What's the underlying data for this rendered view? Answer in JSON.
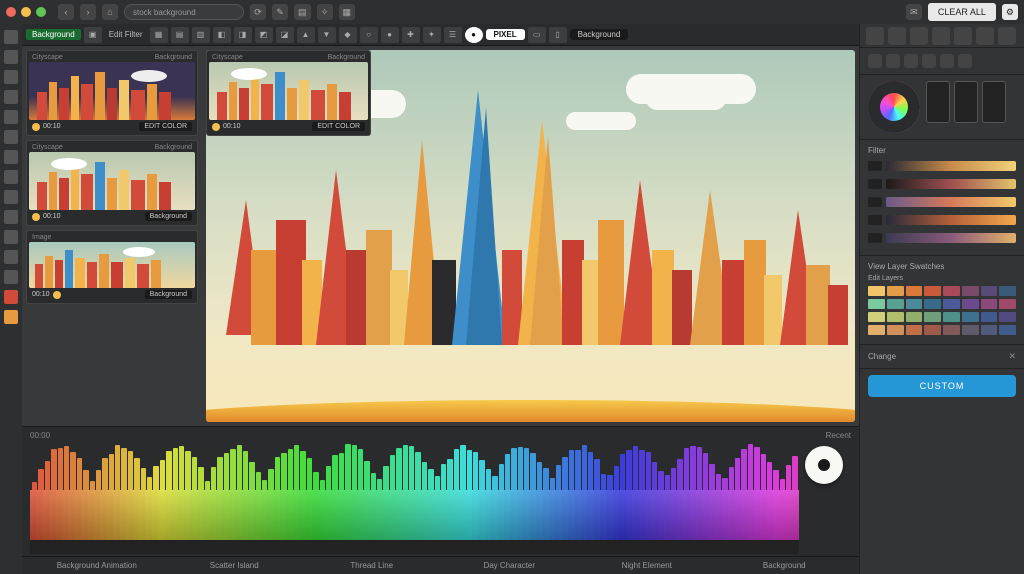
{
  "topbar": {
    "search_placeholder": "stock background",
    "clear_label": "CLEAR ALL",
    "menu_icons": [
      "back-icon",
      "forward-icon",
      "home-icon",
      "undo-icon",
      "redo-icon",
      "crop-icon",
      "layers-icon",
      "fx-icon"
    ]
  },
  "toolbar": {
    "badge": "Background",
    "edit_label": "Edit Filter",
    "pixel_label": "PIXEL",
    "mode_label": "Background",
    "tool_icons_count": 28
  },
  "thumbs": [
    {
      "title": "Cityscape",
      "status": "Background",
      "action": "EDIT COLOR",
      "variant": "night"
    },
    {
      "title": "Cityscape",
      "status": "Background",
      "action": "EDIT COLOR",
      "variant": "day"
    },
    {
      "title": "Cityscape",
      "status": "Background",
      "action": "Background",
      "variant": "dusk"
    },
    {
      "title": "Image",
      "status": "",
      "action": "Background",
      "variant": "sunset"
    }
  ],
  "right": {
    "top_icons": [
      "select-icon",
      "move-icon",
      "brush-icon",
      "eraser-icon",
      "fill-icon",
      "text-icon",
      "shape-icon",
      "eyedropper-icon",
      "crop-icon"
    ],
    "transport_icons": [
      "prev-icon",
      "play-icon",
      "next-icon",
      "stop-icon",
      "loop-icon",
      "rec-icon"
    ],
    "filter_title": "Filter",
    "gradients": [
      "linear-gradient(90deg,#2b2b35,#c78b4a,#f2d27a)",
      "linear-gradient(90deg,#1a1a1a,#a05050,#e2c36a)",
      "linear-gradient(90deg,#6a5a8a,#d77a5a,#f2c96a)",
      "linear-gradient(90deg,#2a2a3a,#b3603a,#f2a84a)",
      "linear-gradient(90deg,#3a3a50,#8a5a7a,#e2b06a)"
    ],
    "layers_title": "View Layer Swatches",
    "layers_sub": "Edit Layers",
    "swatch_rows": [
      [
        "#f2c56a",
        "#e59c4a",
        "#d97a3a",
        "#c95a3a",
        "#a84a5a",
        "#7a4a6a",
        "#5a4a7a",
        "#3a5a7a"
      ],
      [
        "#7ac9a0",
        "#5aa090",
        "#4a8a9a",
        "#3a6a8a",
        "#4a5a9a",
        "#6a4a8a",
        "#8a4a7a",
        "#a04a6a"
      ],
      [
        "#d0d07a",
        "#b0c06a",
        "#90b06a",
        "#70a07a",
        "#50908a",
        "#407090",
        "#405a90",
        "#504a80"
      ],
      [
        "#e2b06a",
        "#d2905a",
        "#c2704a",
        "#a05a4a",
        "#805a5a",
        "#605a6a",
        "#505a7a",
        "#405a8a"
      ]
    ],
    "change_label": "Change",
    "custom_btn": "CUSTOM"
  },
  "timeline": {
    "head_left": "00:00",
    "head_right": "Recent",
    "foot_items": [
      "Background Animation",
      "Scatter Island",
      "Thread Line",
      "Day Character",
      "Night Element",
      "Background"
    ]
  },
  "canvas": {
    "clouds": [
      [
        240,
        40,
        120,
        28
      ],
      [
        520,
        62,
        70,
        18
      ],
      [
        590,
        24,
        130,
        30
      ]
    ],
    "palette": {
      "reds": [
        "#d24a3a",
        "#c73e32",
        "#b83a30",
        "#e25542"
      ],
      "oranges": [
        "#e89a3e",
        "#f2b44a",
        "#f2c96a",
        "#d98a3a"
      ],
      "blue": "#3e8fc9",
      "dark": "#2b2b2d"
    }
  }
}
